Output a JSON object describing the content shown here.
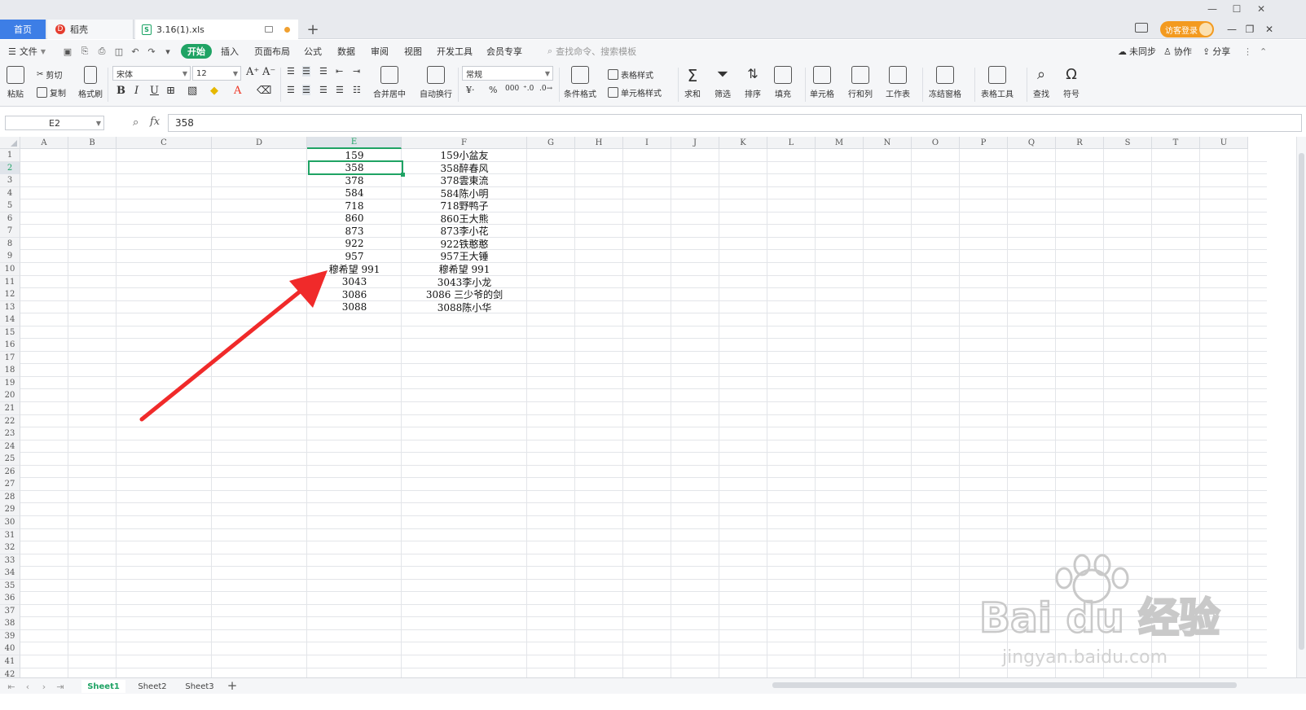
{
  "titlebar": {
    "home_tab": "首页",
    "daoke_tab": "稻壳",
    "file_tab": "3.16(1).xls",
    "login_label": "访客登录"
  },
  "menu": {
    "file": "文件",
    "items": [
      "开始",
      "插入",
      "页面布局",
      "公式",
      "数据",
      "审阅",
      "视图",
      "开发工具",
      "会员专享"
    ],
    "active": "开始",
    "search_placeholder": "查找命令、搜索模板",
    "sync": "未同步",
    "collab": "协作",
    "share": "分享"
  },
  "ribbon": {
    "paste": "粘贴",
    "cut": "剪切",
    "copy": "复制",
    "format_painter": "格式刷",
    "font_name": "宋体",
    "font_size": "12",
    "merge_center": "合并居中",
    "wrap_text": "自动换行",
    "number_format": "常规",
    "conditional_format": "条件格式",
    "table_style": "表格样式",
    "cell_style": "单元格样式",
    "sum": "求和",
    "filter": "筛选",
    "sort": "排序",
    "fill": "填充",
    "cells": "单元格",
    "row_col": "行和列",
    "worksheet": "工作表",
    "freeze": "冻结窗格",
    "table_tools": "表格工具",
    "find": "查找",
    "symbol": "符号"
  },
  "formula_bar": {
    "name_box": "E2",
    "fx": "fx",
    "value": "358"
  },
  "grid": {
    "columns": [
      "A",
      "B",
      "C",
      "D",
      "E",
      "F",
      "G",
      "H",
      "I",
      "J",
      "K",
      "L",
      "M",
      "N",
      "O",
      "P",
      "Q",
      "R",
      "S",
      "T",
      "U"
    ],
    "selected_column": "E",
    "selected_row": 2,
    "row_count": 42,
    "col_e": [
      "159",
      "358",
      "378",
      "584",
      "718",
      "860",
      "873",
      "922",
      "957",
      "穆希望  991",
      "3043",
      "3086",
      "3088"
    ],
    "col_f": [
      "159小盆友",
      "358醉春风",
      "378雲東流",
      "584陈小明",
      "718野鸭子",
      "860王大熊",
      "873李小花",
      "922铁憨憨",
      "957王大锤",
      "穆希望  991",
      "3043李小龙",
      "3086 三少爷的剑",
      "3088陈小华"
    ]
  },
  "sheets": [
    "Sheet1",
    "Sheet2",
    "Sheet3"
  ],
  "active_sheet": "Sheet1",
  "watermark": {
    "brand": "Bai du 经验",
    "url": "jingyan.baidu.com"
  },
  "colors": {
    "accent_green": "#1fa364",
    "arrow_red": "#f02a2a",
    "home_blue": "#3d7ee6",
    "login_orange": "#f39a1f"
  }
}
